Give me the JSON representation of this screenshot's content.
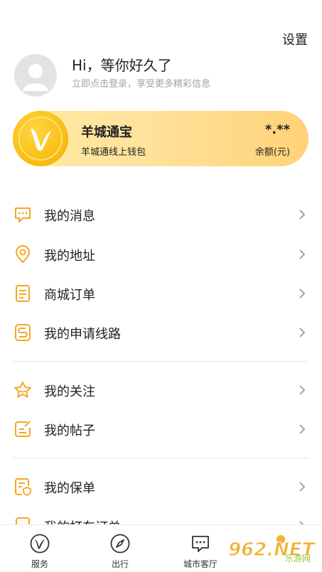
{
  "header": {
    "settings_label": "设置"
  },
  "profile": {
    "greeting": "Hi，等你好久了",
    "login_hint": "立即点击登录，享受更多精彩信息"
  },
  "wallet": {
    "title": "羊城通宝",
    "subtitle": "羊城通线上钱包",
    "balance": "*.**",
    "balance_label": "余额(元)",
    "icon": "yct-v-logo-icon",
    "accent": "#f9bc14"
  },
  "menu": {
    "messages": {
      "label": "我的消息",
      "icon": "message-icon"
    },
    "address": {
      "label": "我的地址",
      "icon": "location-icon"
    },
    "orders": {
      "label": "商城订单",
      "icon": "order-icon"
    },
    "routes": {
      "label": "我的申请线路",
      "icon": "route-icon"
    },
    "follows": {
      "label": "我的关注",
      "icon": "star-icon"
    },
    "posts": {
      "label": "我的帖子",
      "icon": "post-icon"
    },
    "policies": {
      "label": "我的保单",
      "icon": "policy-icon"
    },
    "partial": {
      "label": "我的打车订单",
      "icon": "car-order-icon"
    }
  },
  "tabbar": {
    "services": {
      "label": "服务",
      "icon": "v-logo-icon"
    },
    "travel": {
      "label": "出行",
      "icon": "compass-icon"
    },
    "city": {
      "label": "城市客厅",
      "icon": "chat-icon"
    }
  },
  "watermark": {
    "text": "962.NET",
    "subtext": "乐游网"
  },
  "colors": {
    "icon_orange": "#f5a623",
    "text": "#222222",
    "hint": "#a3a3a3"
  }
}
